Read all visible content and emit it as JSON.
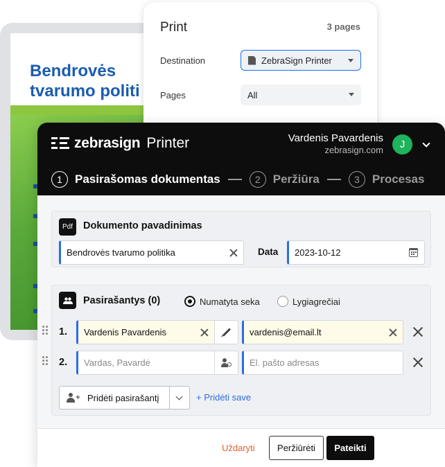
{
  "background_document": {
    "title_line1": "Bendrovės",
    "title_line2": "tvarumo politi"
  },
  "print_dialog": {
    "title": "Print",
    "page_count": "3 pages",
    "destination_label": "Destination",
    "destination_value": "ZebraSign Printer",
    "pages_label": "Pages",
    "pages_value": "All"
  },
  "app": {
    "brand": "zebrasign",
    "product": "Printer",
    "user_name": "Vardenis Pavardenis",
    "user_domain": "zebrasign.com",
    "avatar_initial": "J",
    "accent_color": "#1fb35c"
  },
  "steps": [
    {
      "num": "1",
      "label": "Pasirašomas dokumentas",
      "active": true
    },
    {
      "num": "2",
      "label": "Peržiūra",
      "active": false
    },
    {
      "num": "3",
      "label": "Procesas",
      "active": false
    }
  ],
  "document_panel": {
    "icon_label": "Pdf",
    "title": "Dokumento pavadinimas",
    "name_value": "Bendrovės tvarumo politika",
    "date_label": "Data",
    "date_value": "2023-10-12"
  },
  "signers_panel": {
    "title": "Pasirašantys (0)",
    "order_default": "Numatyta seka",
    "order_parallel": "Lygiagrečiai",
    "rows": [
      {
        "num": "1.",
        "name": "Vardenis Pavardenis",
        "email": "vardenis@email.lt"
      },
      {
        "num": "2.",
        "name_placeholder": "Vardas, Pavardė",
        "email_placeholder": "El. pašto adresas"
      }
    ],
    "add_signer": "Pridėti pasirašantį",
    "add_self": "+ Pridėti save"
  },
  "footer": {
    "close": "Uždaryti",
    "preview": "Peržiūrėti",
    "submit": "Pateikti"
  }
}
